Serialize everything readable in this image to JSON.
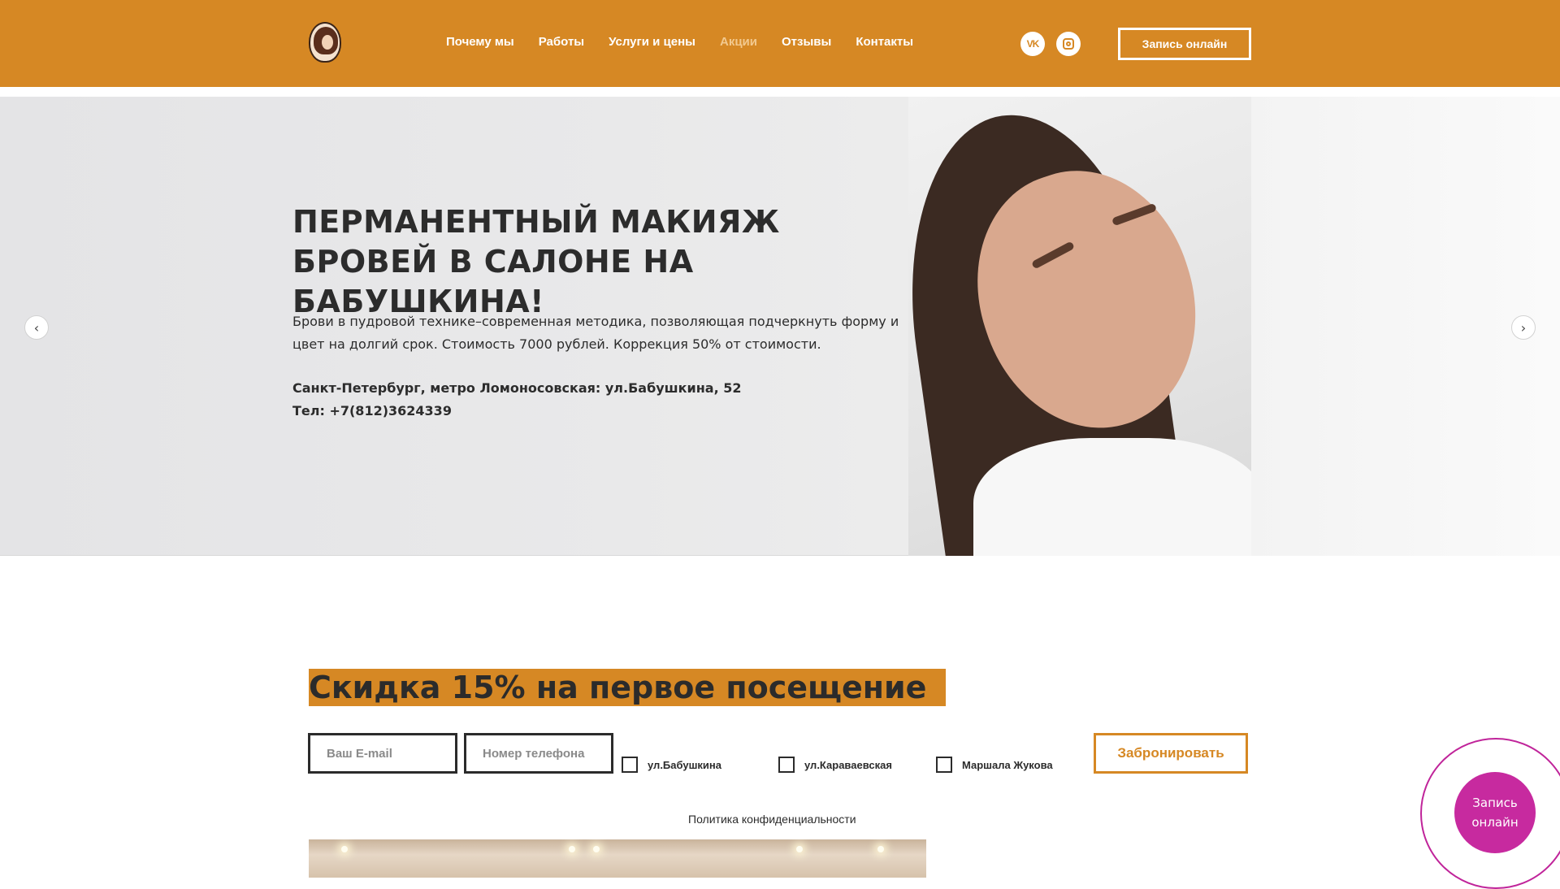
{
  "header": {
    "logo_alt": "Гемма",
    "nav": [
      {
        "label": "Почему мы"
      },
      {
        "label": "Работы"
      },
      {
        "label": "Услуги и цены"
      },
      {
        "label": "Акции"
      },
      {
        "label": "Отзывы"
      },
      {
        "label": "Контакты"
      }
    ],
    "social": {
      "vk": "VK",
      "instagram": "instagram"
    },
    "cta_label": "Запись онлайн"
  },
  "hero": {
    "title": "ПЕРМАНЕНТНЫЙ МАКИЯЖ БРОВЕЙ В САЛОНЕ НА БАБУШКИНА!",
    "text": "Брови в пудровой технике–современная методика, позволяющая подчеркнуть форму и цвет на долгий срок. Стоимость 7000 рублей. Коррекция 50% от стоимости.",
    "address": "Санкт-Петербург, метро Ломоносовская: ул.Бабушкина, 52",
    "phone": "Тел: +7(812)3624339",
    "prev_arrow": "‹",
    "next_arrow": "›"
  },
  "promo": {
    "title": "Скидка 15% на первое посещение",
    "email_placeholder": "Ваш E-mail",
    "phone_placeholder": "Номер телефона",
    "locations": [
      "ул.Бабушкина",
      "ул.Караваевская",
      "Маршала Жукова"
    ],
    "submit_label": "Забронировать",
    "privacy_label": "Политика конфиденциальности"
  },
  "floating": {
    "label": "Запись онлайн"
  },
  "colors": {
    "accent": "#d68824",
    "widget": "#c72a9f"
  }
}
